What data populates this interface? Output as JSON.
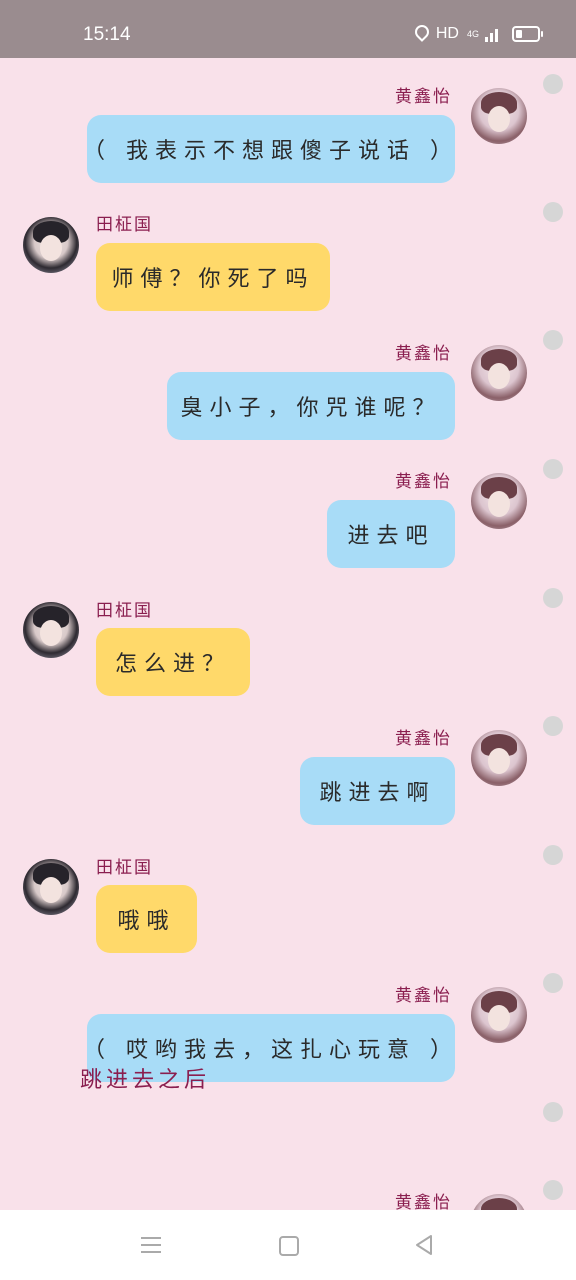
{
  "status_bar": {
    "time": "15:14",
    "network": "HD",
    "signal_label": "4G"
  },
  "characters": {
    "her": "黄鑫怡",
    "him": "田柾国"
  },
  "messages": [
    {
      "sender": "黄鑫怡",
      "side": "right",
      "text": "（ 我表示不想跟傻子说话 ）"
    },
    {
      "sender": "田柾国",
      "side": "left",
      "text": "师傅？你死了吗"
    },
    {
      "sender": "黄鑫怡",
      "side": "right",
      "text": "臭小子，你咒谁呢？"
    },
    {
      "sender": "黄鑫怡",
      "side": "right",
      "text": "进去吧"
    },
    {
      "sender": "田柾国",
      "side": "left",
      "text": "怎么进？"
    },
    {
      "sender": "黄鑫怡",
      "side": "right",
      "text": "跳进去啊"
    },
    {
      "sender": "田柾国",
      "side": "left",
      "text": "哦哦"
    },
    {
      "sender": "黄鑫怡",
      "side": "right",
      "text": "（ 哎哟我去，这扎心玩意 ）"
    },
    {
      "sender": "黄鑫怡",
      "side": "right",
      "text": ""
    }
  ],
  "narration": "跳进去之后",
  "colors": {
    "background": "#f9e1ea",
    "status_bar": "#9a8c8f",
    "bubble_right": "#a8dcf7",
    "bubble_left": "#ffd96a",
    "name_text": "#8a1e4f"
  },
  "icons": {
    "location": "location-icon",
    "battery": "battery-icon",
    "nav_menu": "menu-icon",
    "nav_home": "home-icon",
    "nav_back": "back-icon"
  }
}
